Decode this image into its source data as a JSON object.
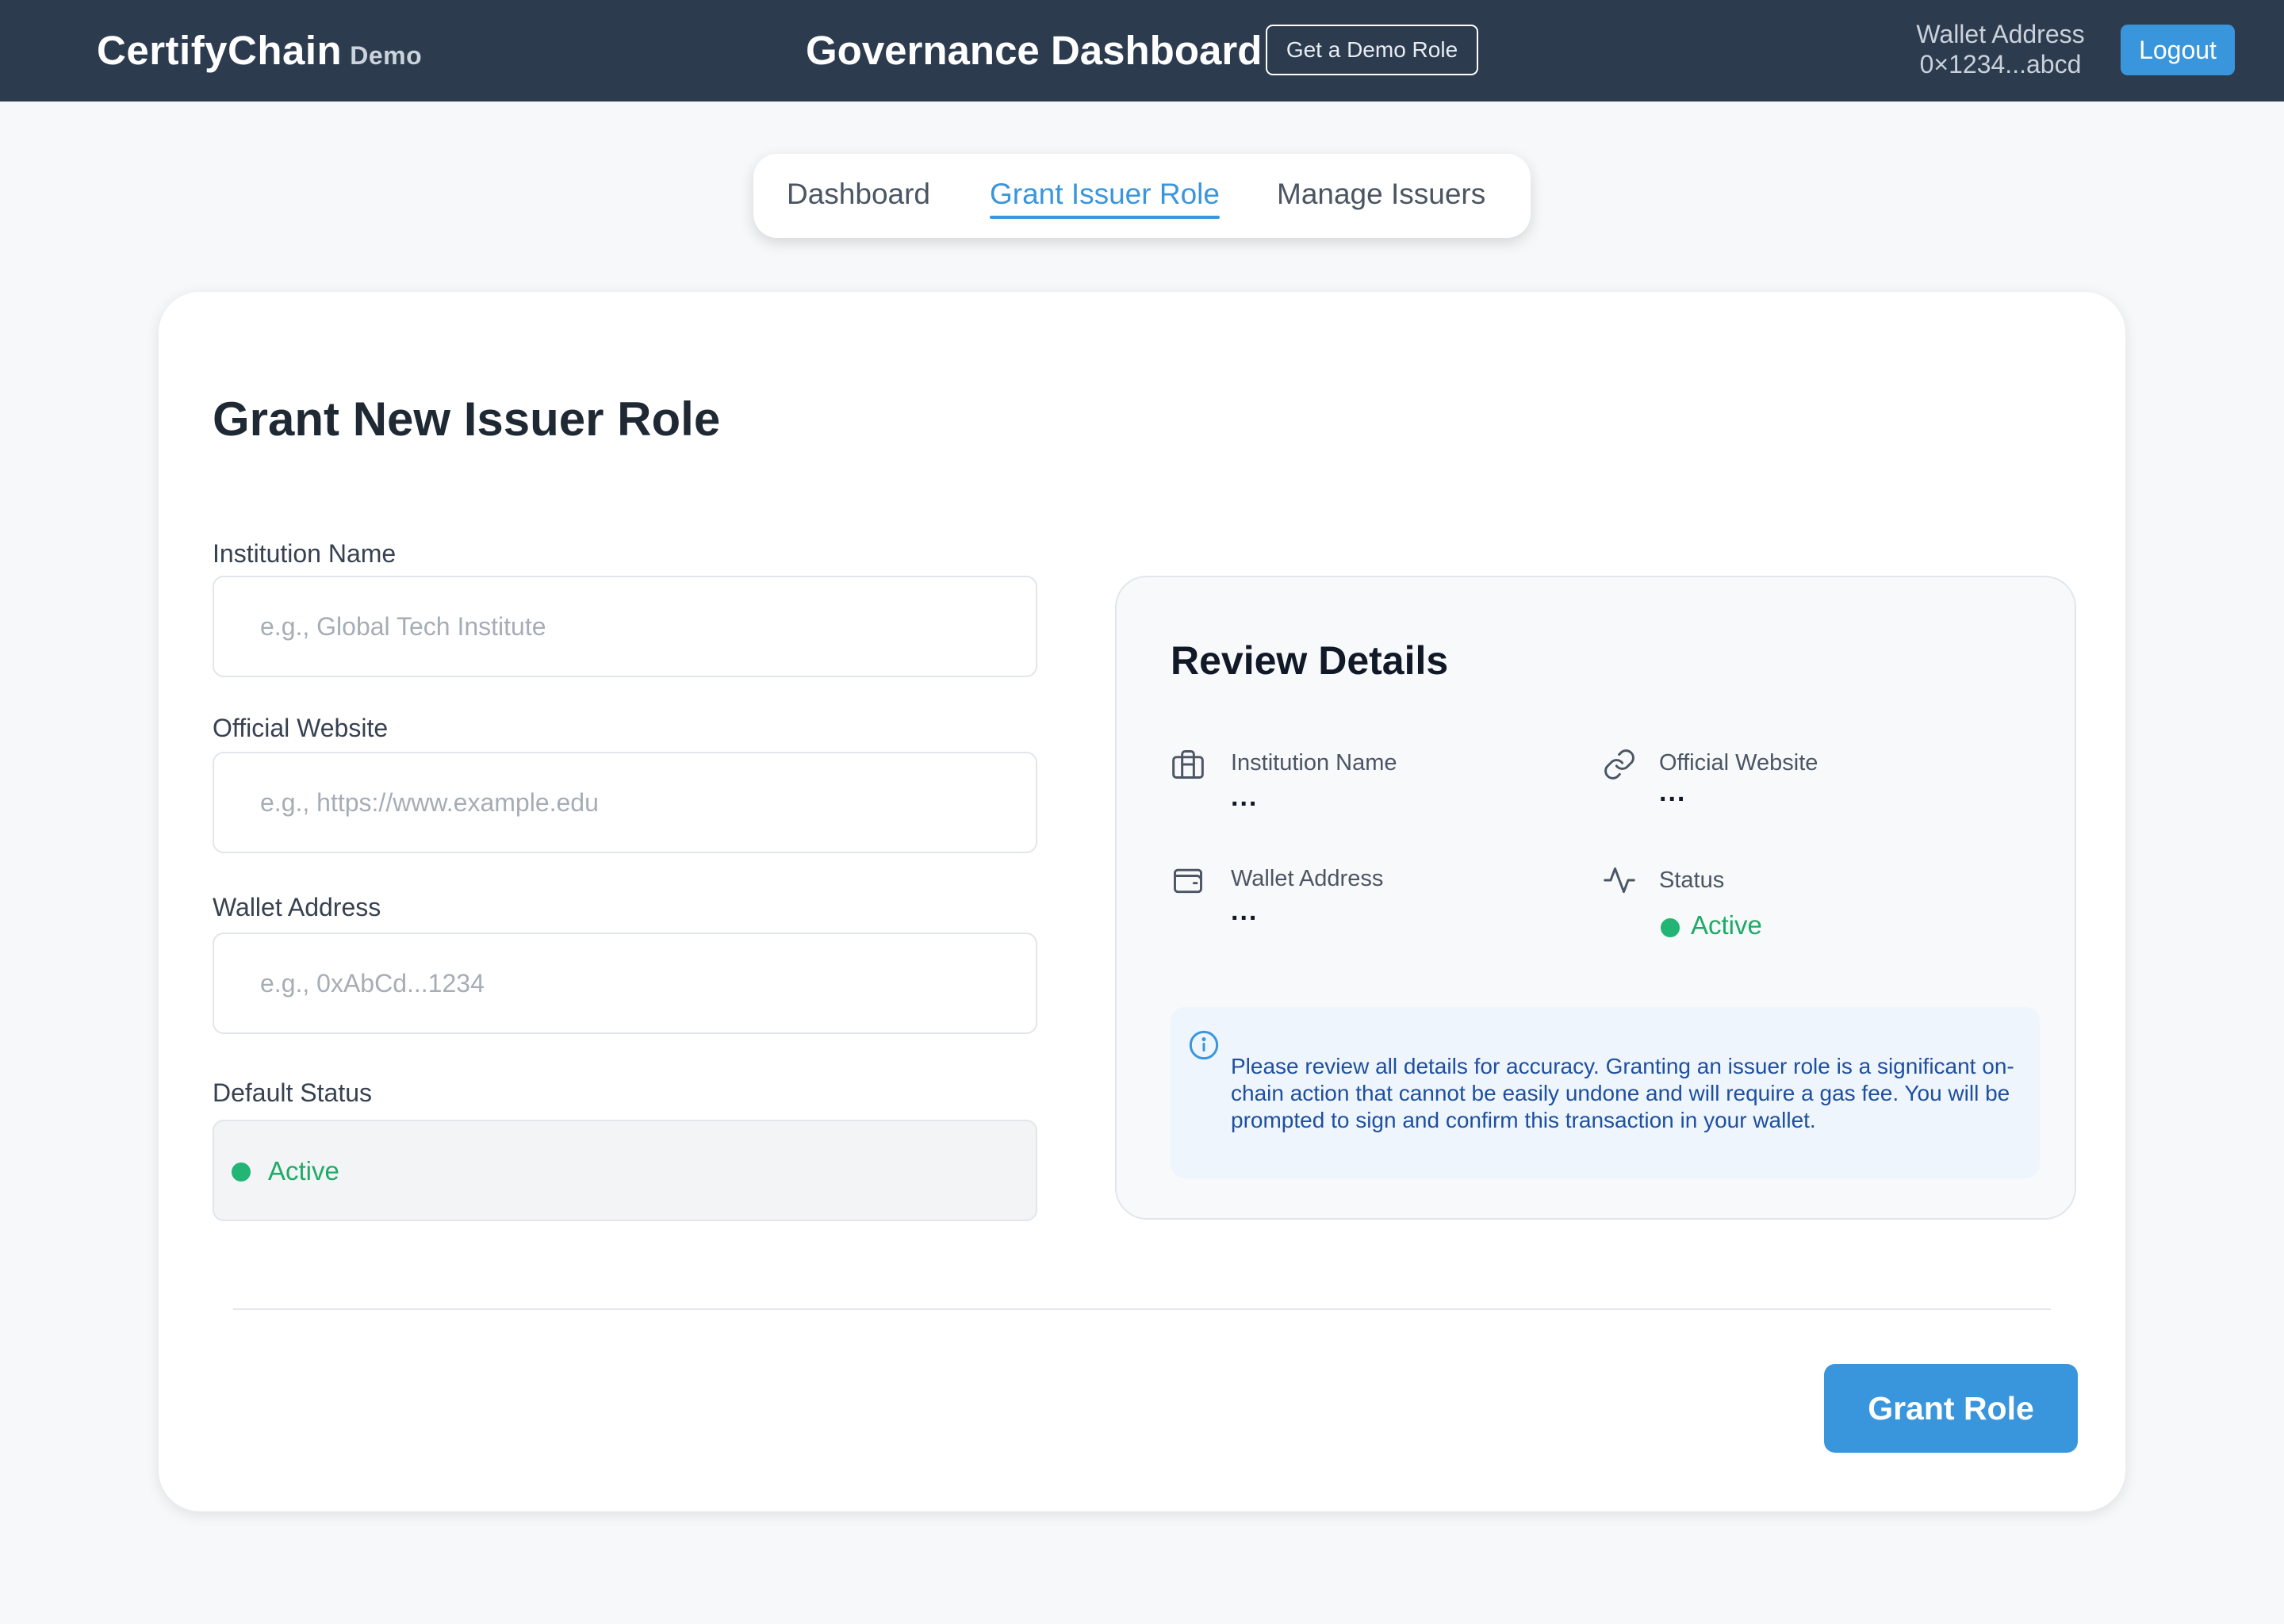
{
  "header": {
    "brand": "CertifyChain",
    "brand_sub": "Demo",
    "title": "Governance Dashboard",
    "demo_button": "Get a Demo Role",
    "wallet_label": "Wallet Address",
    "wallet_value": "0×1234...abcd",
    "logout_button": "Logout"
  },
  "tabs": [
    {
      "label": "Dashboard",
      "active": false
    },
    {
      "label": "Grant Issuer Role",
      "active": true
    },
    {
      "label": "Manage Issuers",
      "active": false
    }
  ],
  "form": {
    "title": "Grant New Issuer Role",
    "fields": [
      {
        "label": "Institution Name",
        "placeholder": "e.g., Global Tech Institute",
        "value": ""
      },
      {
        "label": "Official Website",
        "placeholder": "e.g., https://www.example.edu",
        "value": ""
      },
      {
        "label": "Wallet Address",
        "placeholder": "e.g., 0xAbCd...1234",
        "value": ""
      }
    ],
    "status_label": "Default Status",
    "status_value": "Active"
  },
  "review": {
    "title": "Review Details",
    "items": [
      {
        "label": "Institution Name",
        "value": "...",
        "icon": "building-icon"
      },
      {
        "label": "Official Website",
        "value": "...",
        "icon": "link-icon"
      },
      {
        "label": "Wallet Address",
        "value": "...",
        "icon": "wallet-icon"
      },
      {
        "label": "Status",
        "value": "Active",
        "icon": "activity-icon"
      }
    ],
    "notice_icon": "info-icon",
    "notice": "Please review all details for accuracy. Granting an issuer role is a significant on-chain action that cannot be easily undone and will require a gas fee. You will be prompted to sign and confirm this transaction in your wallet."
  },
  "actions": {
    "grant_button": "Grant Role"
  },
  "colors": {
    "header_bg": "#2d3b4e",
    "accent": "#3a96dc",
    "success": "#22b573",
    "page_bg": "#f6f8fa"
  }
}
